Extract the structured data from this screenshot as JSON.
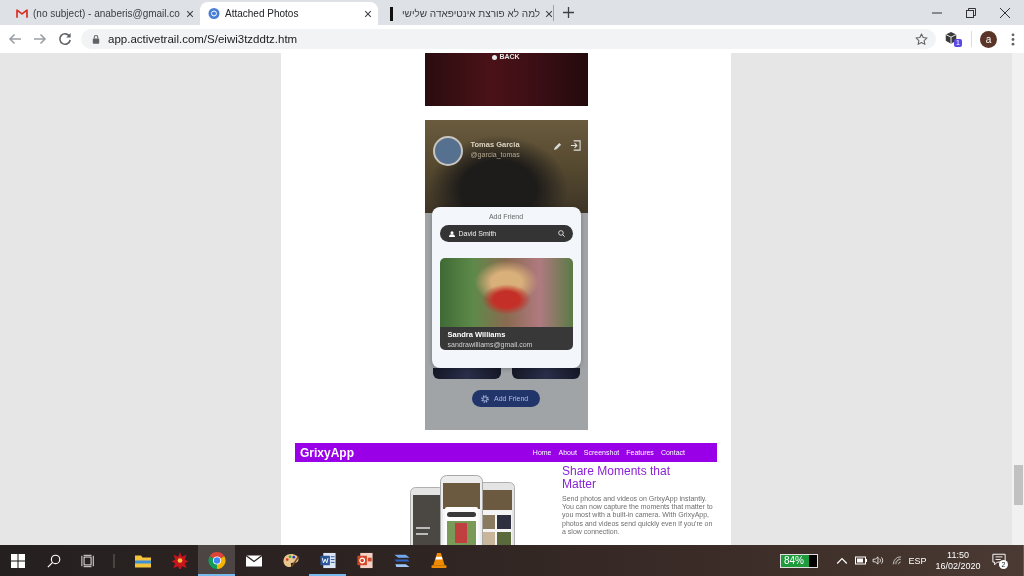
{
  "browser": {
    "tabs": [
      {
        "kind": "mail",
        "title": "(no subject) - anaberis@gmail.co",
        "selected": false
      },
      {
        "kind": "site",
        "title": "Attached Photos",
        "selected": true
      },
      {
        "kind": "bar",
        "title": "למה לא פורצת אינטיפאדה שלישי",
        "selected": false
      }
    ],
    "address": {
      "url": "app.activetrail.com/S/eiwi3tzddtz.htm"
    },
    "extension_badge": "1",
    "profile_initial": "a"
  },
  "email": {
    "top_photo": {
      "caption": "BACK"
    },
    "app_screen": {
      "profile": {
        "name": "Tomas Garcia",
        "handle": "@garcia_tomas"
      },
      "dialog": {
        "title": "Add Friend",
        "search_value": "David Smith",
        "result": {
          "name": "Sandra Williams",
          "email": "sandrawilliams@gmail.com"
        }
      },
      "button": "Add Friend"
    },
    "promo": {
      "logo": "GrixyApp",
      "nav": [
        "Home",
        "About",
        "Screenshot",
        "Features",
        "Contact"
      ],
      "heading": "Share Moments that Matter",
      "body": "Send photos and videos on GrixyApp instantly. You can now capture the moments that matter to you most with a built-in camera. With GrixyApp, photos and videos send quickly even if you're on a slow connection."
    }
  },
  "taskbar": {
    "apps": [
      {
        "kind": "folder",
        "selected": false,
        "open": false
      },
      {
        "kind": "game",
        "selected": false,
        "open": false
      },
      {
        "kind": "browser",
        "selected": true,
        "open": true
      },
      {
        "kind": "mail",
        "selected": false,
        "open": false
      },
      {
        "kind": "paint",
        "selected": false,
        "open": false
      },
      {
        "kind": "word",
        "selected": false,
        "open": true
      },
      {
        "kind": "slides",
        "selected": false,
        "open": false
      },
      {
        "kind": "media",
        "selected": false,
        "open": false
      },
      {
        "kind": "cone",
        "selected": false,
        "open": false
      }
    ],
    "battery_reading": "84%",
    "language": "ESP",
    "time": "11:50",
    "date": "16/02/2020",
    "notifications": "2"
  }
}
